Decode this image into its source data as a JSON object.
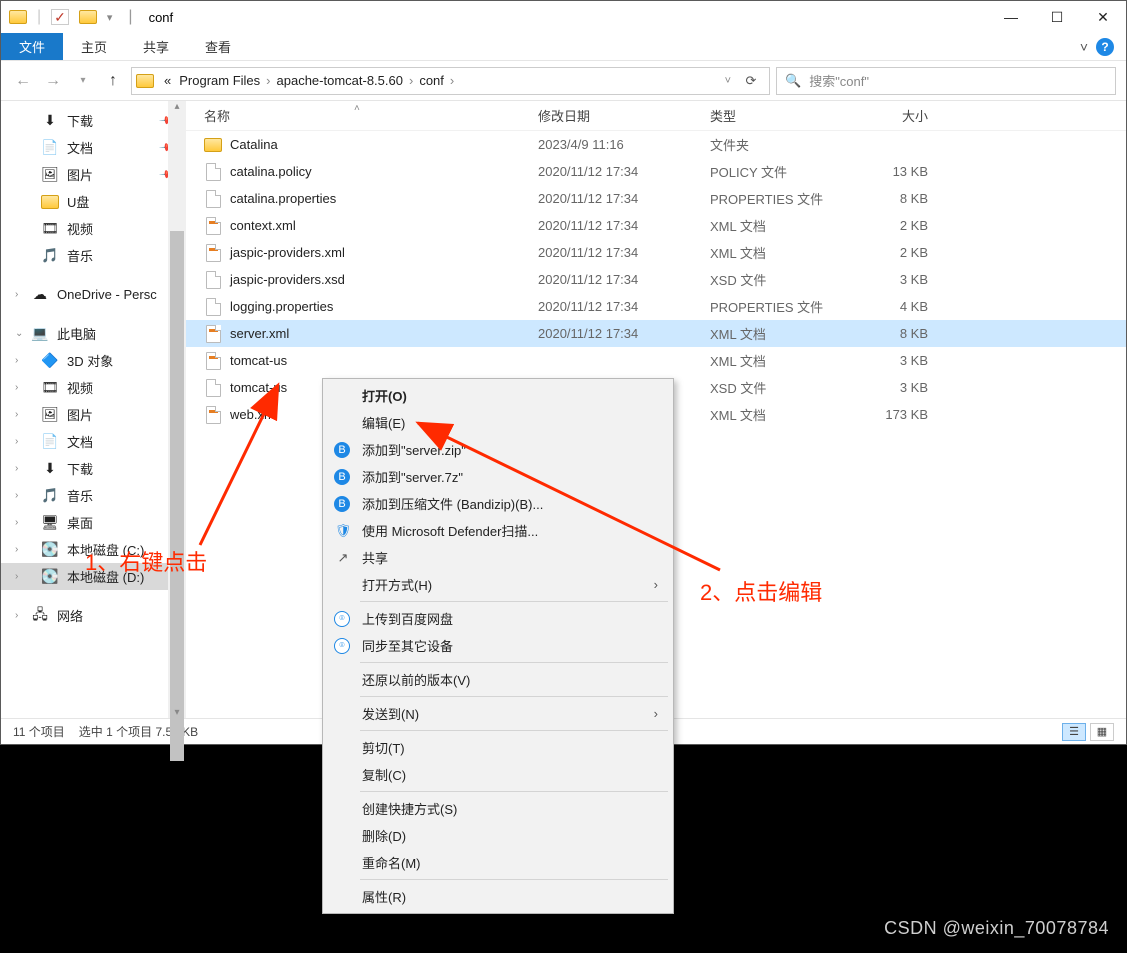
{
  "window": {
    "title": "conf"
  },
  "ribbon": {
    "file": "文件",
    "tabs": [
      "主页",
      "共享",
      "查看"
    ]
  },
  "breadcrumbs": {
    "prefix": "«",
    "items": [
      "Program Files",
      "apache-tomcat-8.5.60",
      "conf"
    ]
  },
  "search": {
    "placeholder": "搜索\"conf\""
  },
  "sidebar": {
    "items": [
      {
        "label": "下载",
        "icon": "download",
        "pinned": true
      },
      {
        "label": "文档",
        "icon": "docs",
        "pinned": true
      },
      {
        "label": "图片",
        "icon": "pics",
        "pinned": true
      },
      {
        "label": "U盘",
        "icon": "folder",
        "pinned": false
      },
      {
        "label": "视频",
        "icon": "video",
        "pinned": false
      },
      {
        "label": "音乐",
        "icon": "music",
        "pinned": false
      }
    ],
    "onedrive": "OneDrive - Persc",
    "thispc": "此电脑",
    "pc_items": [
      {
        "label": "3D 对象",
        "icon": "3d"
      },
      {
        "label": "视频",
        "icon": "video"
      },
      {
        "label": "图片",
        "icon": "pics"
      },
      {
        "label": "文档",
        "icon": "docs"
      },
      {
        "label": "下载",
        "icon": "download"
      },
      {
        "label": "音乐",
        "icon": "music"
      },
      {
        "label": "桌面",
        "icon": "desktop"
      },
      {
        "label": "本地磁盘 (C:)",
        "icon": "disk"
      },
      {
        "label": "本地磁盘 (D:)",
        "icon": "disk",
        "selected": true
      }
    ],
    "network": "网络"
  },
  "columns": {
    "name": "名称",
    "date": "修改日期",
    "type": "类型",
    "size": "大小"
  },
  "files": [
    {
      "name": "Catalina",
      "date": "2023/4/9 11:16",
      "type": "文件夹",
      "size": "",
      "icon": "folder"
    },
    {
      "name": "catalina.policy",
      "date": "2020/11/12 17:34",
      "type": "POLICY 文件",
      "size": "13 KB",
      "icon": "file"
    },
    {
      "name": "catalina.properties",
      "date": "2020/11/12 17:34",
      "type": "PROPERTIES 文件",
      "size": "8 KB",
      "icon": "file"
    },
    {
      "name": "context.xml",
      "date": "2020/11/12 17:34",
      "type": "XML 文档",
      "size": "2 KB",
      "icon": "xml"
    },
    {
      "name": "jaspic-providers.xml",
      "date": "2020/11/12 17:34",
      "type": "XML 文档",
      "size": "2 KB",
      "icon": "xml"
    },
    {
      "name": "jaspic-providers.xsd",
      "date": "2020/11/12 17:34",
      "type": "XSD 文件",
      "size": "3 KB",
      "icon": "file"
    },
    {
      "name": "logging.properties",
      "date": "2020/11/12 17:34",
      "type": "PROPERTIES 文件",
      "size": "4 KB",
      "icon": "file"
    },
    {
      "name": "server.xml",
      "date": "2020/11/12 17:34",
      "type": "XML 文档",
      "size": "8 KB",
      "icon": "xml",
      "selected": true
    },
    {
      "name": "tomcat-us",
      "date": "",
      "type": "XML 文档",
      "size": "3 KB",
      "icon": "xml",
      "truncated": true
    },
    {
      "name": "tomcat-us",
      "date": "",
      "type": "XSD 文件",
      "size": "3 KB",
      "icon": "file",
      "truncated": true
    },
    {
      "name": "web.xml",
      "date": "",
      "type": "XML 文档",
      "size": "173 KB",
      "icon": "xml"
    }
  ],
  "status": {
    "items": "11 个项目",
    "selected": "选中 1 个项目 7.57 KB"
  },
  "context_menu": {
    "items": [
      {
        "label": "打开(O)",
        "bold": true
      },
      {
        "label": "编辑(E)"
      },
      {
        "label": "添加到\"server.zip\"",
        "icon": "bz"
      },
      {
        "label": "添加到\"server.7z\"",
        "icon": "bz"
      },
      {
        "label": "添加到压缩文件 (Bandizip)(B)...",
        "icon": "bz"
      },
      {
        "label": "使用 Microsoft Defender扫描...",
        "icon": "shield"
      },
      {
        "label": "共享",
        "icon": "share"
      },
      {
        "label": "打开方式(H)",
        "submenu": true
      },
      {
        "sep": true
      },
      {
        "label": "上传到百度网盘",
        "icon": "baidu"
      },
      {
        "label": "同步至其它设备",
        "icon": "baidu"
      },
      {
        "sep": true
      },
      {
        "label": "还原以前的版本(V)"
      },
      {
        "sep": true
      },
      {
        "label": "发送到(N)",
        "submenu": true
      },
      {
        "sep": true
      },
      {
        "label": "剪切(T)"
      },
      {
        "label": "复制(C)"
      },
      {
        "sep": true
      },
      {
        "label": "创建快捷方式(S)"
      },
      {
        "label": "删除(D)"
      },
      {
        "label": "重命名(M)"
      },
      {
        "sep": true
      },
      {
        "label": "属性(R)"
      }
    ]
  },
  "annotations": {
    "a1": "1、右键点击",
    "a2": "2、点击编辑"
  },
  "watermark": "CSDN @weixin_70078784"
}
